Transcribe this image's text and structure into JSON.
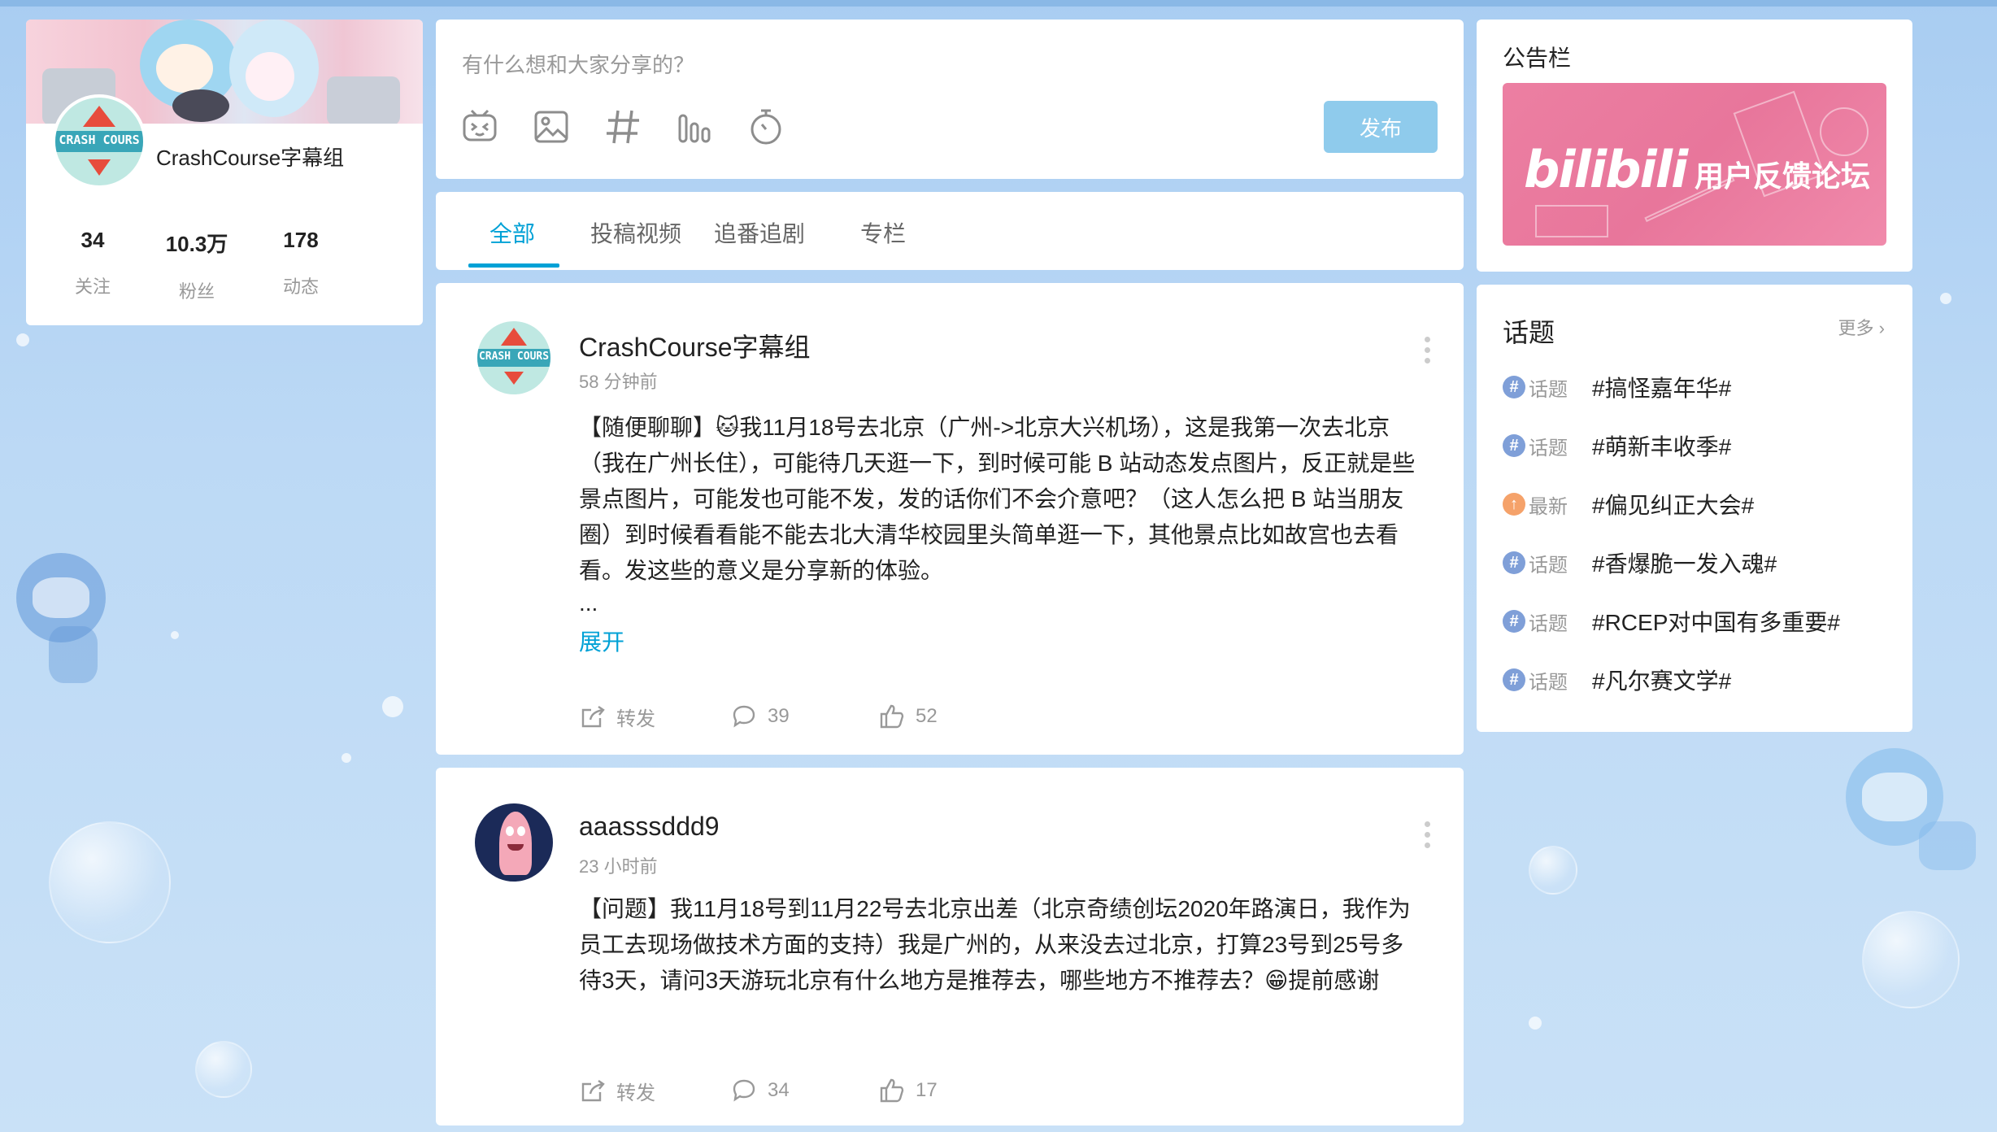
{
  "profile": {
    "name": "CrashCourse字幕组",
    "avatar_text": "CRASH COURS",
    "stats": [
      {
        "value": "34",
        "label": "关注"
      },
      {
        "value": "10.3万",
        "label": "粉丝"
      },
      {
        "value": "178",
        "label": "动态"
      }
    ]
  },
  "composer": {
    "placeholder": "有什么想和大家分享的？",
    "tools": [
      "emoji-icon",
      "image-icon",
      "hashtag-icon",
      "poll-icon",
      "timer-icon"
    ],
    "publish_label": "发布"
  },
  "tabs": [
    {
      "label": "全部",
      "active": true
    },
    {
      "label": "投稿视频",
      "active": false
    },
    {
      "label": "追番追剧",
      "active": false
    },
    {
      "label": "专栏",
      "active": false
    }
  ],
  "posts": [
    {
      "username": "CrashCourse字幕组",
      "time": "58 分钟前",
      "text": "【随便聊聊】🐱我11月18号去北京（广州->北京大兴机场），这是我第一次去北京（我在广州长住），可能待几天逛一下，到时候可能 B 站动态发点图片，反正就是些景点图片，可能发也可能不发，发的话你们不会介意吧？（这人怎么把 B 站当朋友圈）到时候看看能不能去北大清华校园里头简单逛一下，其他景点比如故宫也去看看。发这些的意义是分享新的体验。",
      "ellipsis": "...",
      "expand_label": "展开",
      "forward_label": "转发",
      "comments": "39",
      "likes": "52"
    },
    {
      "username": "aaasssddd9",
      "time": "23 小时前",
      "text": "【问题】我11月18号到11月22号去北京出差（北京奇绩创坛2020年路演日，我作为员工去现场做技术方面的支持）我是广州的，从来没去过北京，打算23号到25号多待3天，请问3天游玩北京有什么地方是推荐去，哪些地方不推荐去？😁提前感谢",
      "forward_label": "转发",
      "comments": "34",
      "likes": "17"
    }
  ],
  "notice": {
    "title": "公告栏",
    "banner_logo": "bilibili",
    "banner_text": "用户反馈论坛"
  },
  "topics": {
    "title": "话题",
    "more_label": "更多",
    "items": [
      {
        "badge": "话题",
        "badge_type": "topic",
        "text": "#搞怪嘉年华#"
      },
      {
        "badge": "话题",
        "badge_type": "topic",
        "text": "#萌新丰收季#"
      },
      {
        "badge": "最新",
        "badge_type": "new",
        "text": "#偏见纠正大会#"
      },
      {
        "badge": "话题",
        "badge_type": "topic",
        "text": "#香爆脆一发入魂#"
      },
      {
        "badge": "话题",
        "badge_type": "topic",
        "text": "#RCEP对中国有多重要#"
      },
      {
        "badge": "话题",
        "badge_type": "topic",
        "text": "#凡尔赛文学#"
      }
    ]
  },
  "colors": {
    "accent": "#00a1d6",
    "publish_button": "#8fcbec",
    "topic_badge": "#7f9fd8",
    "new_badge": "#f5a26a"
  }
}
